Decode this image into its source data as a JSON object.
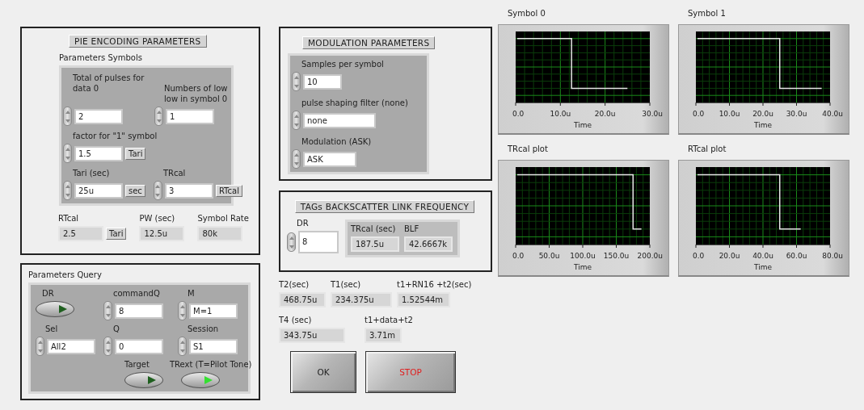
{
  "pie": {
    "title": "PIE ENCODING PARAMETERS",
    "section_label": "Parameters Symbols",
    "rows": [
      [
        {
          "label": "Total of pulses for data 0",
          "value": "2"
        },
        {
          "label": "Numbers of low low in symbol 0",
          "value": "1"
        }
      ],
      [
        {
          "label": "factor for \"1\" symbol",
          "value": "1.5",
          "unit": "Tari"
        }
      ],
      [
        {
          "label": "Tari (sec)",
          "value": "25u",
          "unit": "sec"
        },
        {
          "label": "TRcal",
          "value": "3",
          "unit": "RTcal"
        }
      ]
    ],
    "indicators": [
      {
        "label": "RTcal",
        "value": "2.5",
        "unit": "Tari"
      },
      {
        "label": "PW (sec)",
        "value": "12.5u"
      },
      {
        "label": "Symbol Rate",
        "value": "80k"
      }
    ]
  },
  "query": {
    "title": "Parameters Query",
    "rows": [
      [
        {
          "kind": "switch",
          "label": "DR",
          "on": false
        },
        {
          "kind": "numeric",
          "label": "commandQ",
          "value": "8"
        },
        {
          "kind": "numeric",
          "label": "M",
          "value": "M=1"
        }
      ],
      [
        {
          "kind": "numeric",
          "label": "Sel",
          "value": "All2"
        },
        {
          "kind": "numeric",
          "label": "Q",
          "value": "0"
        },
        {
          "kind": "numeric",
          "label": "Session",
          "value": "S1"
        }
      ],
      [
        "",
        {
          "kind": "switch",
          "label": "Target",
          "on": false
        },
        {
          "kind": "switch",
          "label": "TRext (T=Pilot Tone)",
          "on": true
        }
      ]
    ]
  },
  "modulation": {
    "title": "MODULATION PARAMETERS",
    "controls": [
      {
        "label": "Samples per symbol",
        "value": "10"
      },
      {
        "label": "pulse shaping filter (none)",
        "value": "none"
      },
      {
        "label": "Modulation (ASK)",
        "value": "ASK"
      }
    ]
  },
  "blf": {
    "title": "TAGs BACKSCATTER LINK FREQUENCY",
    "control": {
      "label": "DR",
      "value": "8"
    },
    "indicators": [
      {
        "label": "TRcal (sec)",
        "value": "187.5u"
      },
      {
        "label": "BLF",
        "value": "42.6667k"
      }
    ]
  },
  "timing": [
    [
      {
        "label": "T2(sec)",
        "value": "468.75u"
      },
      {
        "label": "T1(sec)",
        "value": "234.375u"
      },
      {
        "label": "t1+RN16 +t2(sec)",
        "value": "1.52544m"
      }
    ],
    [
      {
        "label": "T4 (sec)",
        "value": "343.75u"
      },
      {
        "label": "t1+data+t2",
        "value": "3.71m"
      }
    ]
  ],
  "buttons": [
    {
      "kind": "ok",
      "label": "OK"
    },
    {
      "kind": "stop",
      "label": "STOP"
    }
  ],
  "graphs": [
    {
      "title": "Symbol 0",
      "x_tick_labels": [
        "0.0",
        "10.0u",
        "20.0u",
        "30.0u"
      ],
      "x_axis_label": "Time"
    },
    {
      "title": "Symbol 1",
      "x_tick_labels": [
        "0.0",
        "10.0u",
        "20.0u",
        "30.0u",
        "40.0u"
      ],
      "x_axis_label": "Time"
    },
    {
      "title": "TRcal plot",
      "x_tick_labels": [
        "0.0",
        "50.0u",
        "100.0u",
        "150.0u",
        "200.0u"
      ],
      "x_axis_label": "Time"
    },
    {
      "title": "RTcal plot",
      "x_tick_labels": [
        "0.0",
        "20.0u",
        "40.0u",
        "60.0u",
        "80.0u"
      ],
      "x_axis_label": "Time"
    }
  ]
}
